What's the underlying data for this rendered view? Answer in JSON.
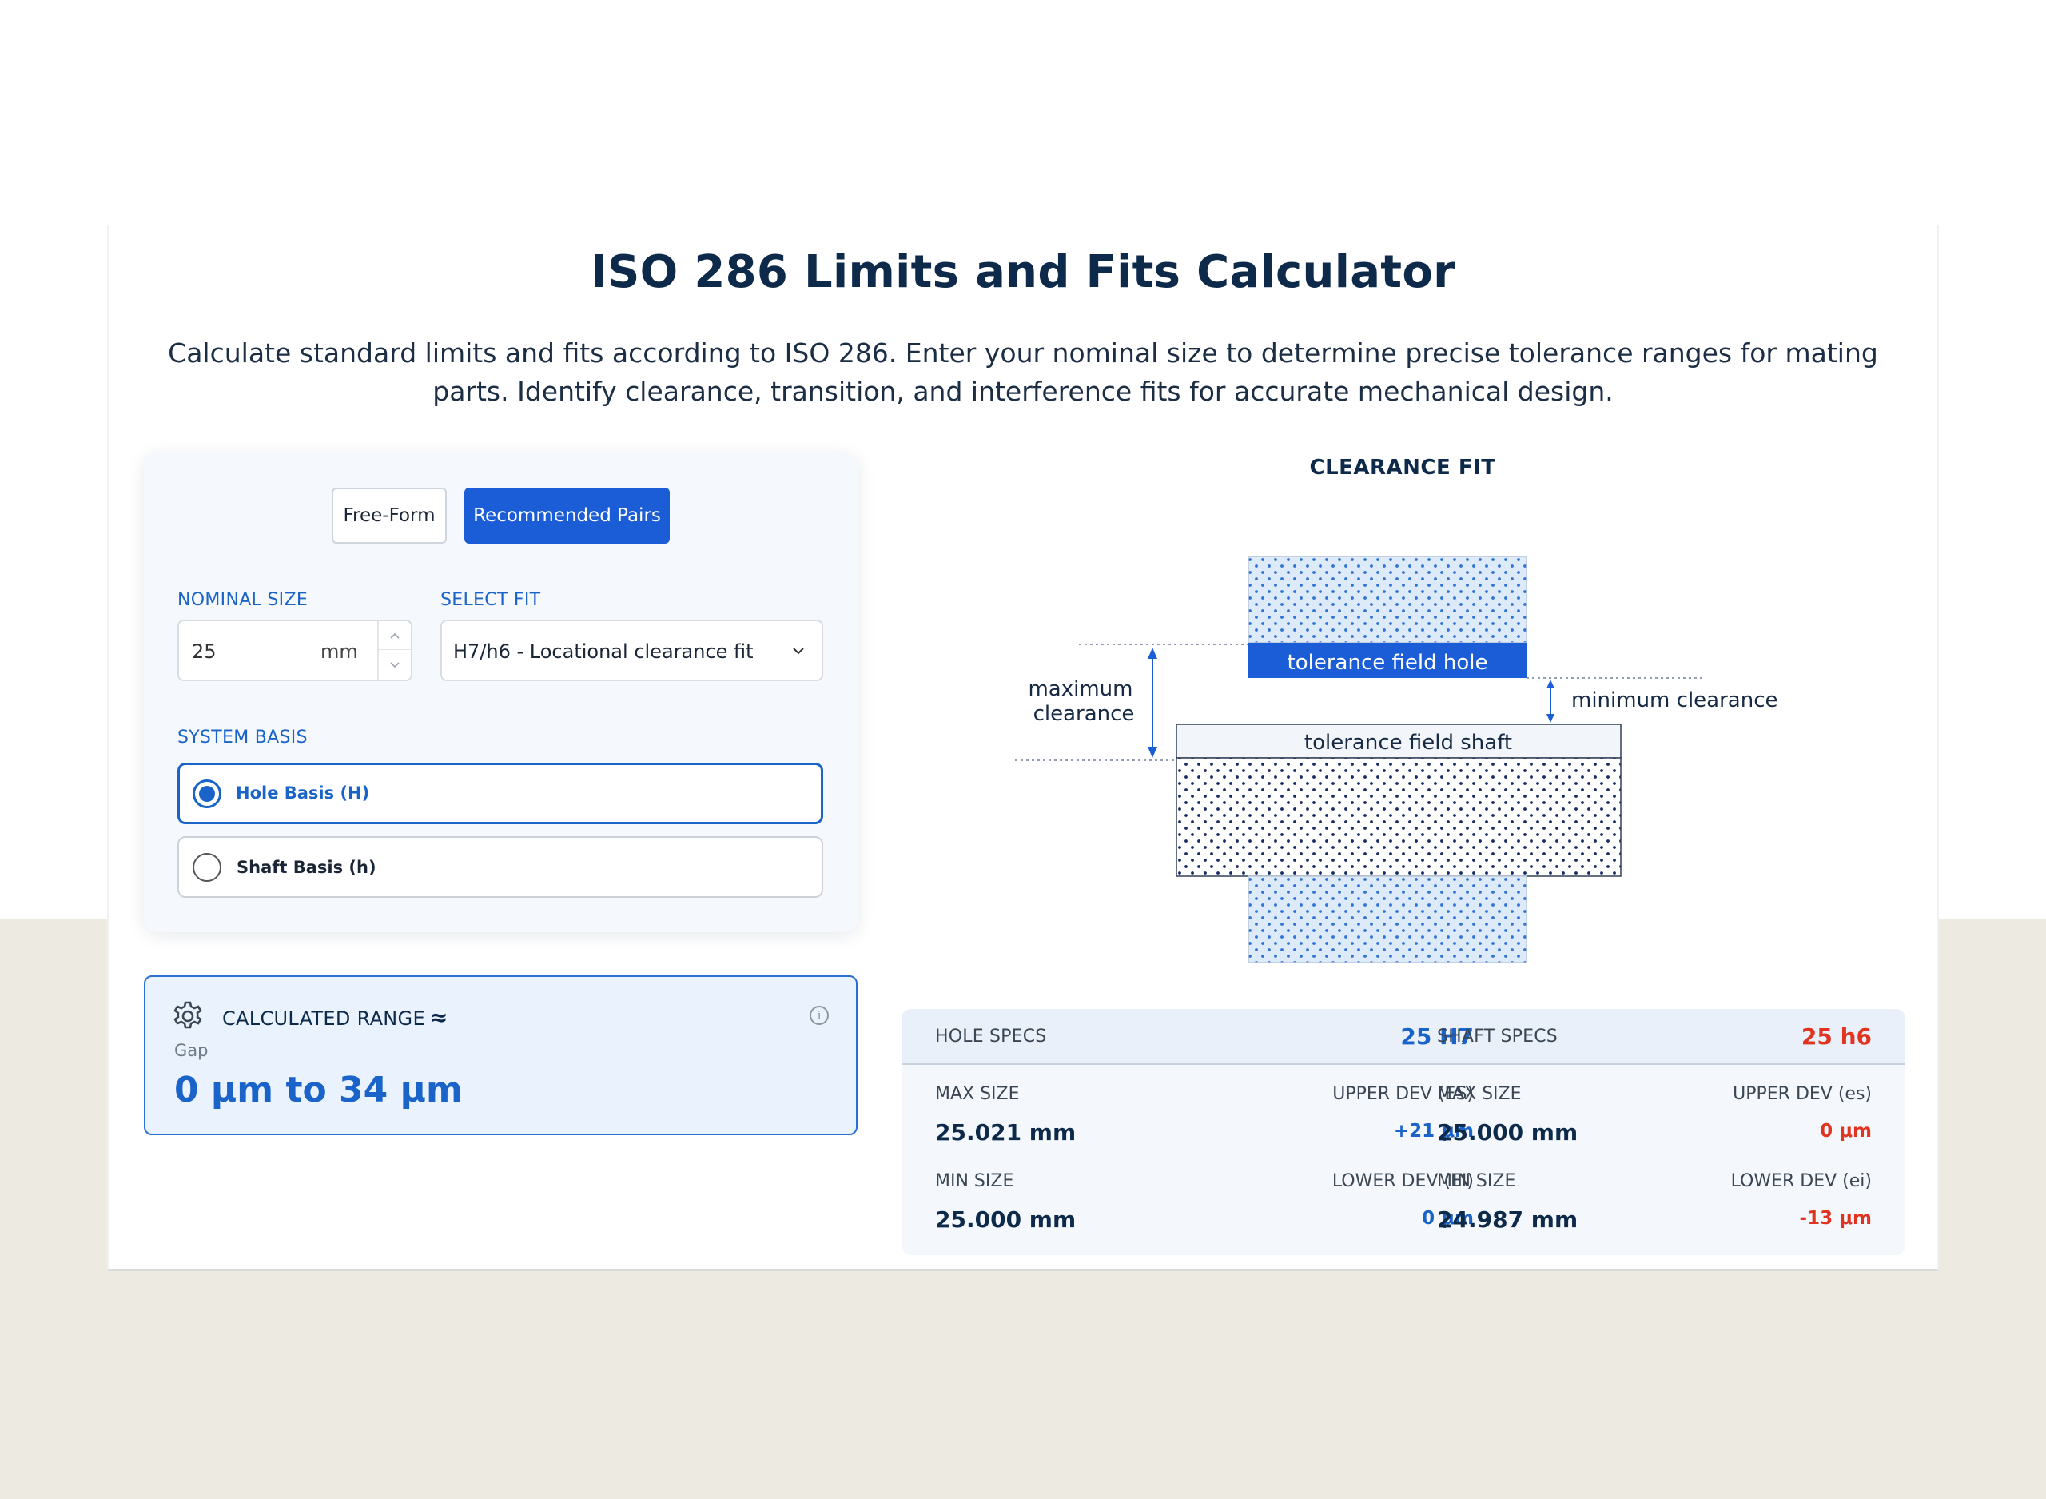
{
  "header": {
    "title": "ISO 286 Limits and Fits Calculator",
    "description": "Calculate standard limits and fits according to ISO 286. Enter your nominal size to determine precise tolerance ranges for mating parts. Identify clearance, transition, and interference fits for accurate mechanical design."
  },
  "mode": {
    "free_form": "Free-Form",
    "recommended_pairs": "Recommended Pairs",
    "active": "Recommended Pairs"
  },
  "inputs": {
    "nominal_size_label": "NOMINAL SIZE",
    "nominal_size_value": "25",
    "nominal_size_unit": "mm",
    "select_fit_label": "SELECT FIT",
    "select_fit_value": "H7/h6 - Locational clearance fit"
  },
  "system_basis": {
    "label": "SYSTEM BASIS",
    "options": [
      {
        "label": "Hole Basis (H)",
        "selected": true
      },
      {
        "label": "Shaft Basis (h)",
        "selected": false
      }
    ]
  },
  "calculated_range": {
    "title": "CALCULATED RANGE",
    "approx_symbol": "≈",
    "sub_label": "Gap",
    "value": "0 μm to 34 μm",
    "info_icon": "info-icon"
  },
  "diagram": {
    "title": "CLEARANCE FIT",
    "hole_label": "tolerance field hole",
    "shaft_label": "tolerance field shaft",
    "max_clearance_line1": "maximum",
    "max_clearance_line2": "clearance",
    "min_clearance": "minimum clearance"
  },
  "specs": {
    "hole": {
      "header": "HOLE SPECS",
      "designation": "25 H7",
      "max_size_label": "MAX SIZE",
      "max_size": "25.021 mm",
      "upper_dev_label": "UPPER DEV (ES)",
      "upper_dev": "+21 μm",
      "min_size_label": "MIN SIZE",
      "min_size": "25.000 mm",
      "lower_dev_label": "LOWER DEV (EI)",
      "lower_dev": "0 μm"
    },
    "shaft": {
      "header": "SHAFT SPECS",
      "designation": "25 h6",
      "max_size_label": "MAX SIZE",
      "max_size": "25.000 mm",
      "upper_dev_label": "UPPER DEV (es)",
      "upper_dev": "0 μm",
      "min_size_label": "MIN SIZE",
      "min_size": "24.987 mm",
      "lower_dev_label": "LOWER DEV (ei)",
      "lower_dev": "-13 μm"
    }
  },
  "colors": {
    "primary_blue": "#1a64c9",
    "button_blue": "#1a5dd6",
    "shaft_red": "#e03420",
    "navy": "#0d2a4a",
    "page_beige": "#edebe1"
  }
}
